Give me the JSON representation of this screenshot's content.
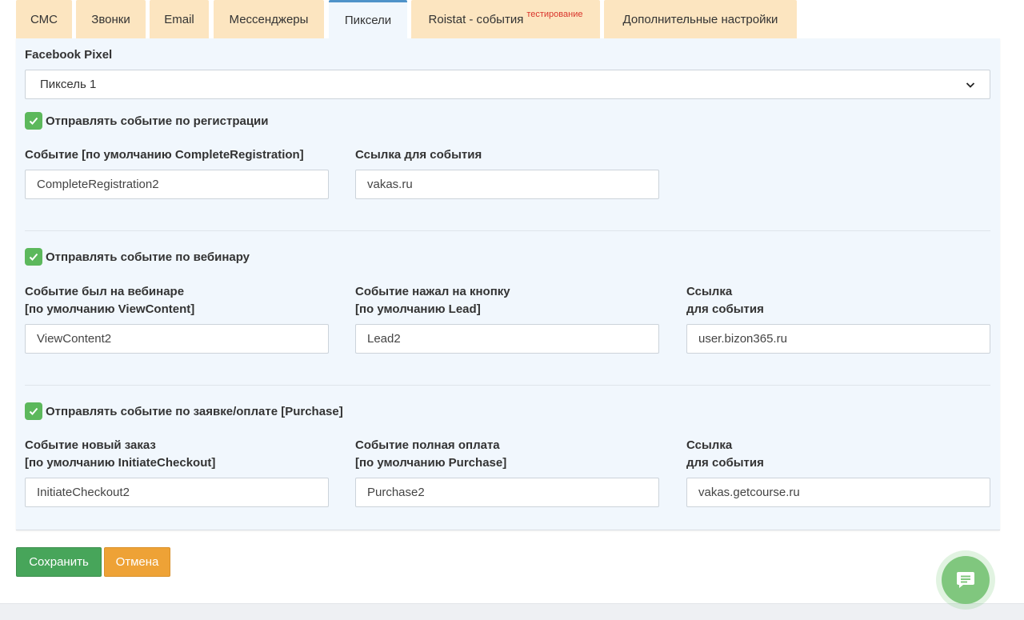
{
  "tabs": [
    {
      "label": "СМС"
    },
    {
      "label": "Звонки"
    },
    {
      "label": "Email"
    },
    {
      "label": "Мессенджеры"
    },
    {
      "label": "Пиксели",
      "active": true
    },
    {
      "label": "Roistat - события",
      "badge": "тестирование"
    },
    {
      "label": "Дополнительные настройки"
    }
  ],
  "pixel": {
    "label": "Facebook Pixel",
    "selected": "Пиксель 1"
  },
  "registration": {
    "checkbox_label": "Отправлять событие по регистрации",
    "checked": true,
    "event_label": "Событие [по умолчанию CompleteRegistration]",
    "event_value": "CompleteRegistration2",
    "link_label": "Ссылка для события",
    "link_value": "vakas.ru"
  },
  "webinar": {
    "checkbox_label": "Отправлять событие по вебинару",
    "checked": true,
    "event_label_line1": "Событие был на вебинаре",
    "event_label_line2": "[по умолчанию ViewContent]",
    "event_value": "ViewContent2",
    "button_label_line1": "Событие нажал на кнопку",
    "button_label_line2": "[по умолчанию Lead]",
    "button_value": "Lead2",
    "link_label_line1": "Ссылка",
    "link_label_line2": "для события",
    "link_value": "user.bizon365.ru"
  },
  "purchase": {
    "checkbox_label": "Отправлять событие по заявке/оплате [Purchase]",
    "checked": true,
    "order_label_line1": "Событие новый заказ",
    "order_label_line2": "[по умолчанию InitiateCheckout]",
    "order_value": "InitiateCheckout2",
    "paid_label_line1": "Событие полная оплата",
    "paid_label_line2": "[по умолчанию Purchase]",
    "paid_value": "Purchase2",
    "link_label_line1": "Ссылка",
    "link_label_line2": "для события",
    "link_value": "vakas.getcourse.ru"
  },
  "actions": {
    "save_label": "Сохранить",
    "cancel_label": "Отмена"
  },
  "colors": {
    "accent_blue": "#4f93c9",
    "tab_bg": "#fce5c0",
    "panel_bg": "#f1f7fd",
    "save_green": "#47a55a",
    "cancel_orange": "#eea236",
    "checkbox_green": "#5cb85c",
    "badge_red": "#d9342b"
  },
  "icons": {
    "select_arrow": "chevron-down-icon",
    "checkbox": "checkmark-icon",
    "chat": "chat-icon"
  }
}
